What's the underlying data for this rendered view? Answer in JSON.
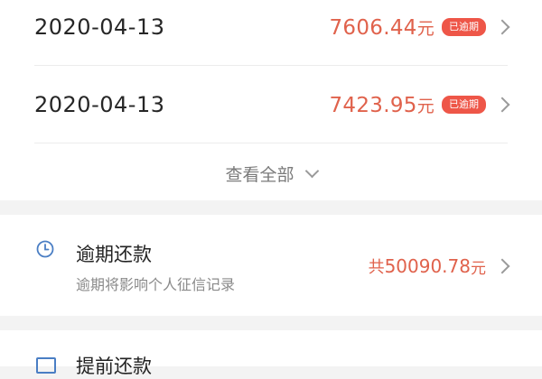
{
  "records": [
    {
      "date": "2020-04-13",
      "amount": "7606.44",
      "unit": "元",
      "badge": "已逾期"
    },
    {
      "date": "2020-04-13",
      "amount": "7423.95",
      "unit": "元",
      "badge": "已逾期"
    }
  ],
  "view_all_label": "查看全部",
  "overdue": {
    "title": "逾期还款",
    "subtitle": "逾期将影响个人征信记录",
    "total_prefix": "共",
    "total_value": "50090.78",
    "total_unit": "元",
    "icon": "clock-icon"
  },
  "prepay": {
    "title": "提前还款",
    "icon": "calendar-icon"
  },
  "colors": {
    "accent_red": "#e0624c",
    "badge_red": "#ee5648",
    "blue_icon": "#4a7ec4"
  }
}
